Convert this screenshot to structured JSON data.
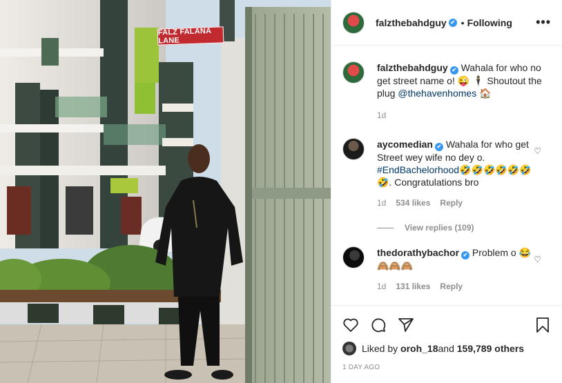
{
  "photo": {
    "street_sign": "FALZ FALANA LANE"
  },
  "header": {
    "username": "falzthebahdguy",
    "verified": "✔",
    "separator": "•",
    "follow_status": "Following",
    "more": "•••"
  },
  "caption": {
    "username": "falzthebahdguy",
    "text_before": "Wahala for who no get street name o! 😜 🕴 Shoutout the plug ",
    "mention": "@thehavenhomes",
    "text_after": " 🏠",
    "time": "1d"
  },
  "comments": [
    {
      "username": "aycomedian",
      "text_before": "Wahala for who get Street wey wife no dey o. ",
      "hashtag": "#EndBachelorhood",
      "text_after": "🤣🤣🤣🤣🤣🤣🤣. Congratulations bro",
      "time": "1d",
      "likes": "534 likes",
      "reply": "Reply",
      "view_replies": "View replies (109)"
    },
    {
      "username": "thedorathybachor",
      "text": "Problem o 😂🙈🙈🙈",
      "time": "1d",
      "likes": "131 likes",
      "reply": "Reply"
    }
  ],
  "footer": {
    "liked_prefix": "Liked by ",
    "liked_user": "oroh_18",
    "liked_mid": " and ",
    "liked_count": "159,789 others",
    "posted_ago": "1 DAY AGO"
  }
}
